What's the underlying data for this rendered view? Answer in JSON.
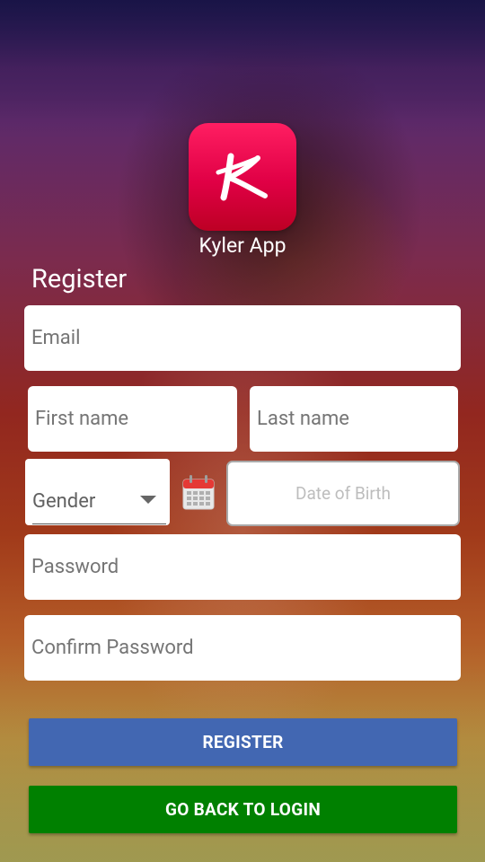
{
  "app": {
    "name": "Kyler App",
    "logo_letter": "K"
  },
  "form": {
    "heading": "Register",
    "email_placeholder": "Email",
    "first_name_placeholder": "First name",
    "last_name_placeholder": "Last name",
    "gender_selected": "Gender",
    "dob_placeholder": "Date of Birth",
    "password_placeholder": "Password",
    "confirm_password_placeholder": "Confirm Password"
  },
  "buttons": {
    "register_label": "REGISTER",
    "login_label": "GO BACK TO LOGIN"
  },
  "colors": {
    "register_button": "#4267b2",
    "login_button": "#008000",
    "logo": "#e00045"
  },
  "icons": {
    "calendar": "calendar-icon",
    "dropdown": "chevron-down-icon"
  }
}
